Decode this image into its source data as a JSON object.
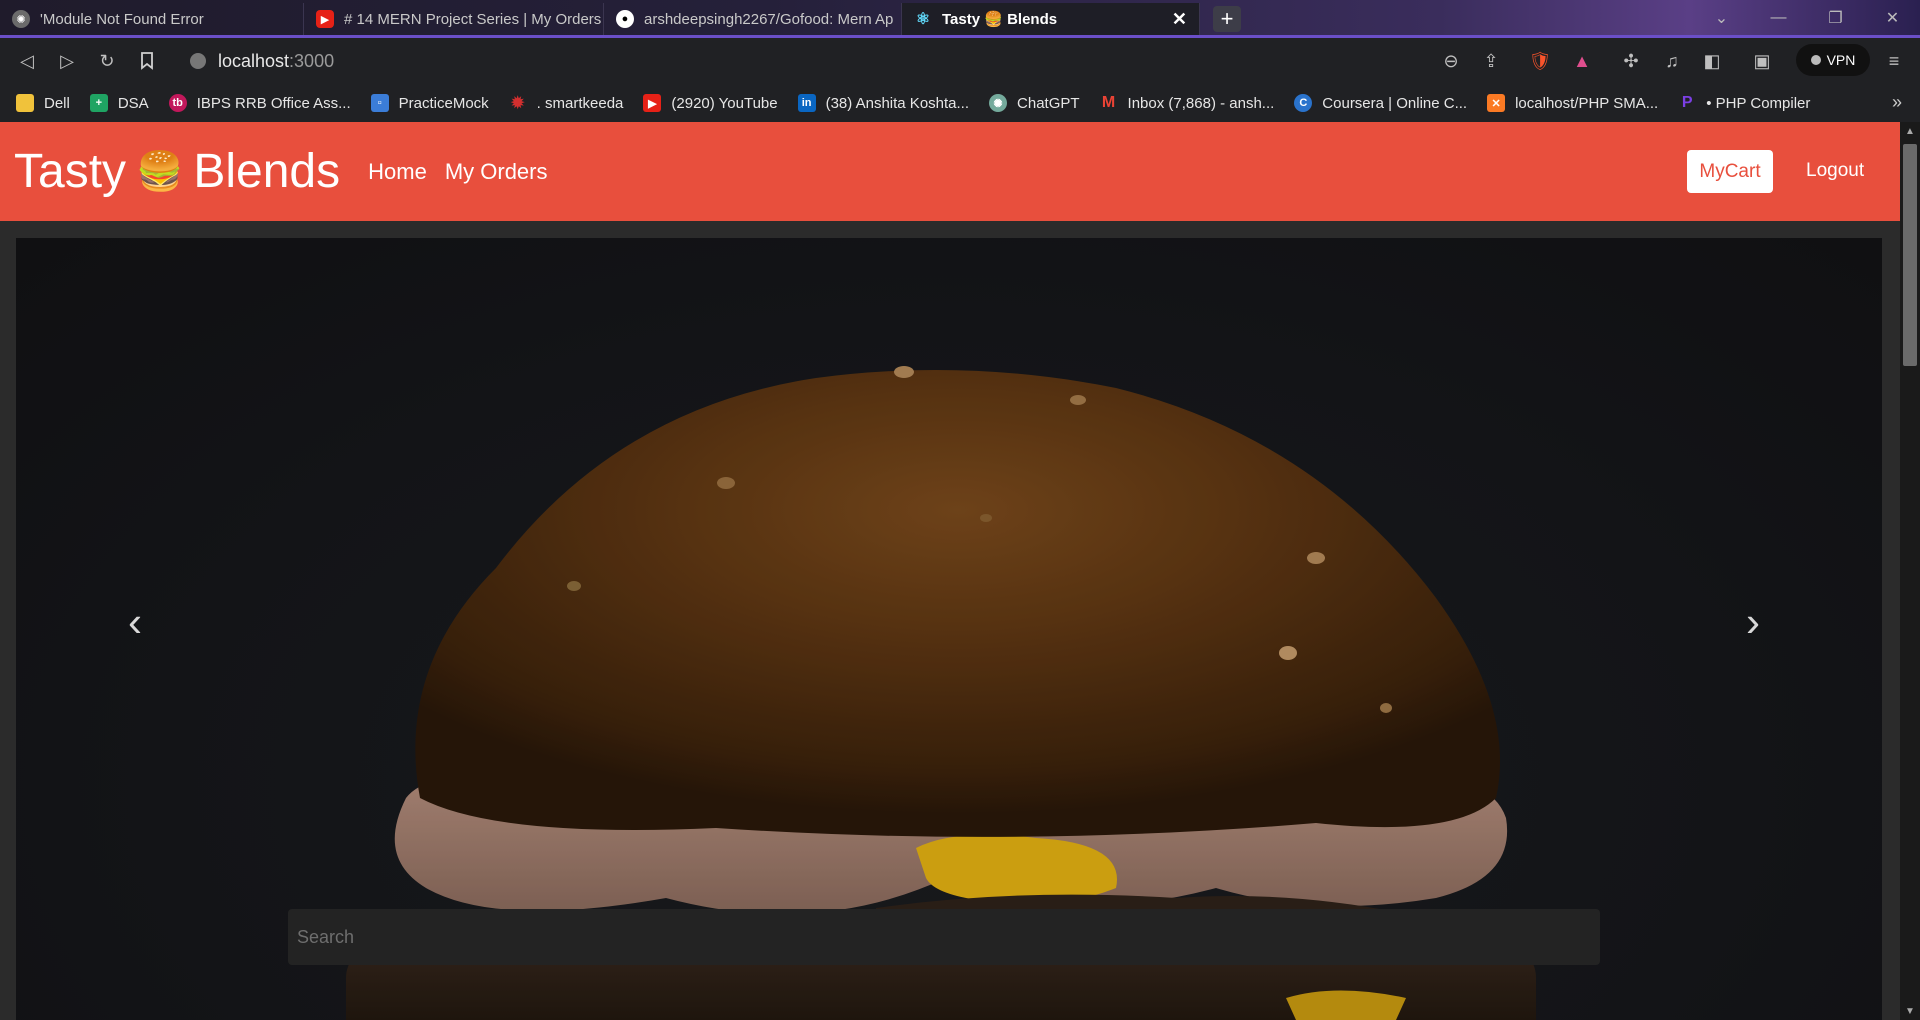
{
  "browser": {
    "tabs": [
      {
        "title": "'Module Not Found Error",
        "favicon": "chatgpt-icon",
        "color": "#6b6b6b",
        "active": false
      },
      {
        "title": "# 14 MERN Project Series | My Orders",
        "favicon": "youtube-icon",
        "color": "#e62117",
        "active": false
      },
      {
        "title": "arshdeepsingh2267/Gofood: Mern Ap",
        "favicon": "github-icon",
        "color": "#ffffff",
        "active": false
      },
      {
        "title": "Tasty 🍔 Blends",
        "favicon": "react-icon",
        "color": "#61dafb",
        "active": true
      }
    ],
    "new_tab": "+",
    "url_host": "localhost",
    "url_port": ":3000",
    "vpn_label": "VPN",
    "bookmarks": [
      {
        "label": "Dell",
        "icon": "folder-icon",
        "color": "#f0c23b"
      },
      {
        "label": "DSA",
        "icon": "sheets-icon",
        "color": "#1fa463"
      },
      {
        "label": "IBPS RRB Office Ass...",
        "icon": "testbook-icon",
        "color": "#c2185b"
      },
      {
        "label": "PracticeMock",
        "icon": "practicemock-icon",
        "color": "#3b7dd8"
      },
      {
        "label": ". smartkeeda",
        "icon": "smartkeeda-icon",
        "color": "#d32f2f"
      },
      {
        "label": "(2920) YouTube",
        "icon": "youtube-icon",
        "color": "#e62117"
      },
      {
        "label": "(38) Anshita Koshta...",
        "icon": "linkedin-icon",
        "color": "#0a66c2"
      },
      {
        "label": "ChatGPT",
        "icon": "chatgpt-icon",
        "color": "#74aa9c"
      },
      {
        "label": "Inbox (7,868) - ansh...",
        "icon": "gmail-icon",
        "color": "#ea4335"
      },
      {
        "label": "Coursera | Online C...",
        "icon": "coursera-icon",
        "color": "#2a73cc"
      },
      {
        "label": "localhost/PHP SMA...",
        "icon": "xampp-icon",
        "color": "#fb7a24"
      },
      {
        "label": "• PHP Compiler",
        "icon": "programiz-icon",
        "color": "#7b3fe4"
      }
    ]
  },
  "site": {
    "brand_left": "Tasty",
    "brand_emoji": "🍔",
    "brand_right": "Blends",
    "nav": [
      "Home",
      "My Orders"
    ],
    "cart_label": "MyCart",
    "logout_label": "Logout",
    "brand_color": "#e84f3d",
    "search_placeholder": "Search"
  }
}
